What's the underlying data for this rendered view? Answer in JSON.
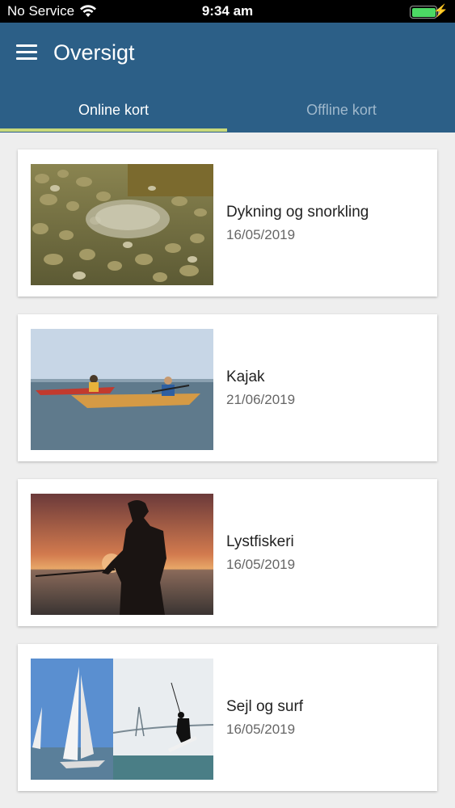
{
  "status_bar": {
    "carrier": "No Service",
    "time": "9:34 am"
  },
  "header": {
    "title": "Oversigt"
  },
  "tabs": [
    {
      "label": "Online kort",
      "active": true
    },
    {
      "label": "Offline kort",
      "active": false
    }
  ],
  "colors": {
    "header": "#2c5f87",
    "tab_indicator": "#c9d97a",
    "background": "#eeeeee"
  },
  "cards": [
    {
      "title": "Dykning og snorkling",
      "date": "16/05/2019",
      "image": "stone-seabed-photo"
    },
    {
      "title": "Kajak",
      "date": "21/06/2019",
      "image": "kayaks-photo"
    },
    {
      "title": "Lystfiskeri",
      "date": "16/05/2019",
      "image": "angler-sunset-photo"
    },
    {
      "title": "Sejl og surf",
      "date": "16/05/2019",
      "image": "sailing-kitesurf-photo"
    }
  ]
}
